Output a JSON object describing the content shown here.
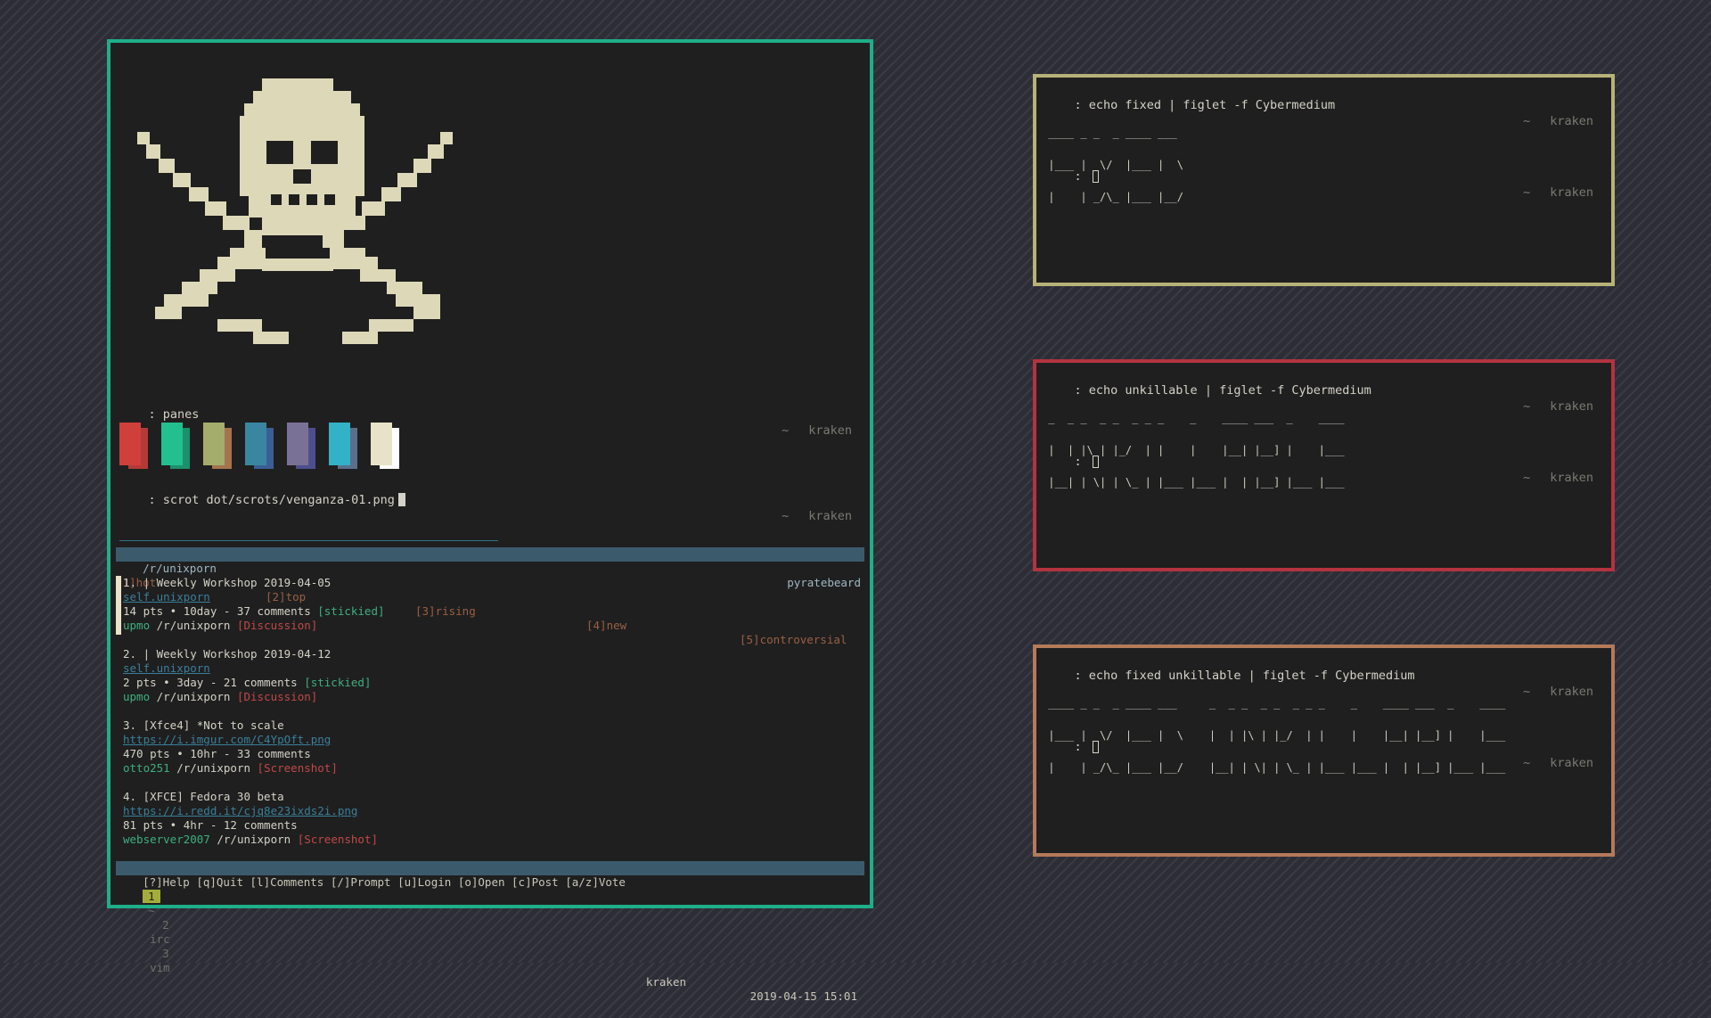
{
  "colors": {
    "main_border": "#1fae8a",
    "fixed_border": "#b7b277",
    "unkillable_border": "#b3333f",
    "combined_border": "#b47a5a",
    "swatches": [
      "#d0403a",
      "#22c08e",
      "#a4ad6b",
      "#3a86a0",
      "#7a7196",
      "#33b1c6",
      "#e8e3c8"
    ],
    "swatches_shadow": [
      "#b43a3a",
      "#1d8f6c",
      "#a5734f",
      "#3b5e94",
      "#4e4e8e",
      "#5a6f8a",
      "#ffffff"
    ]
  },
  "main": {
    "panes_cmd": ": panes",
    "prompt_host": "kraken",
    "tilde": "~",
    "scrot_cmd": ": scrot dot/scrots/venganza-01.png",
    "reddit": {
      "subreddit": "/r/unixporn",
      "user": "pyratebeard",
      "tabs": [
        "[1]hot",
        "[2]top",
        "[3]rising",
        "[4]new",
        "[5]controversial"
      ],
      "posts": [
        {
          "title": "1. | Weekly Workshop 2019-04-05",
          "link": "self.unixporn",
          "meta": "14 pts • 10day - 37 comments",
          "tag": "[stickied]",
          "author": "upmo",
          "sub": "/r/unixporn",
          "flair": "[Discussion]"
        },
        {
          "title": "2. | Weekly Workshop 2019-04-12",
          "link": "self.unixporn",
          "meta": "2 pts • 3day - 21 comments",
          "tag": "[stickied]",
          "author": "upmo",
          "sub": "/r/unixporn",
          "flair": "[Discussion]"
        },
        {
          "title": "3. [Xfce4] *Not to scale",
          "link": "https://i.imgur.com/C4YpOft.png",
          "meta": "470 pts • 10hr - 33 comments",
          "tag": "",
          "author": "otto251",
          "sub": "/r/unixporn",
          "flair": "[Screenshot]"
        },
        {
          "title": "4. [XFCE] Fedora 30 beta",
          "link": "https://i.redd.it/cjq8e23ixds2i.png",
          "meta": "81 pts • 4hr - 12 comments",
          "tag": "",
          "author": "webserver2007",
          "sub": "/r/unixporn",
          "flair": "[Screenshot]"
        }
      ],
      "help": "[?]Help [q]Quit [l]Comments [/]Prompt [u]Login [o]Open [c]Post [a/z]Vote"
    },
    "tmux": {
      "windows": [
        "1",
        "~",
        "2",
        "irc",
        "3",
        "vim"
      ],
      "host": "kraken",
      "datetime": "2019-04-15 15:01"
    }
  },
  "terminals": [
    {
      "cmd": ": echo fixed | figlet -f Cybermedium",
      "host": "kraken",
      "tilde": "~",
      "prompt": ": ",
      "figlet": [
        " ____ _ _  _ ____ ___ ",
        " |___ |  \\/  |___ |  \\",
        " |    | _/\\_ |___ |__/"
      ]
    },
    {
      "cmd": ": echo unkillable | figlet -f Cybermedium",
      "host": "kraken",
      "tilde": "~",
      "prompt": ": ",
      "figlet": [
        " _  _ _  _ _  _ _ _    _    ____ ___  _    ____",
        " |  | |\\ | |_/  | |    |    |__| |__] |    |___",
        " |__| | \\| | \\_ | |___ |___ |  | |__] |___ |___"
      ]
    },
    {
      "cmd": ": echo fixed unkillable | figlet -f Cybermedium",
      "host": "kraken",
      "tilde": "~",
      "prompt": ": ",
      "figlet": [
        " ____ _ _  _ ____ ___     _  _ _  _ _  _ _ _    _    ____ ___  _    ____",
        " |___ |  \\/  |___ |  \\    |  | |\\ | |_/  | |    |    |__| |__] |    |___",
        " |    | _/\\_ |___ |__/    |__| | \\| | \\_ | |___ |___ |  | |__] |___ |___"
      ]
    }
  ]
}
